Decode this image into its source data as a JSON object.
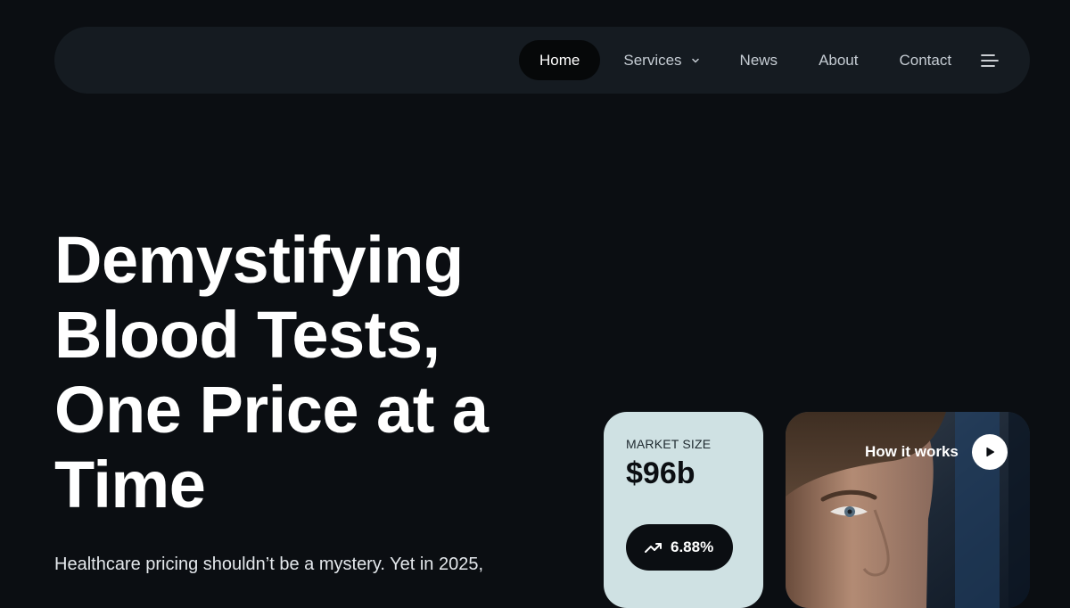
{
  "nav": {
    "items": [
      {
        "label": "Home",
        "active": true
      },
      {
        "label": "Services",
        "active": false,
        "has_dropdown": true
      },
      {
        "label": "News",
        "active": false
      },
      {
        "label": "About",
        "active": false
      },
      {
        "label": "Contact",
        "active": false
      }
    ],
    "menu_icon": "hamburger-menu-icon",
    "dropdown_icon": "chevron-down-icon"
  },
  "hero": {
    "title": "Demystifying Blood Tests, One Price at a Time",
    "description": "Healthcare pricing shouldn’t be a mystery. Yet in 2025,"
  },
  "market_card": {
    "label": "MARKET SIZE",
    "value": "$96b",
    "growth": "6.88%",
    "growth_icon": "trending-up-icon"
  },
  "video_card": {
    "label": "How it works",
    "play_icon": "play-icon"
  },
  "colors": {
    "background": "#0b0e12",
    "navbar": "#151b21",
    "active_pill": "#060809",
    "market_card": "#cfe1e3",
    "text": "#ffffff"
  }
}
